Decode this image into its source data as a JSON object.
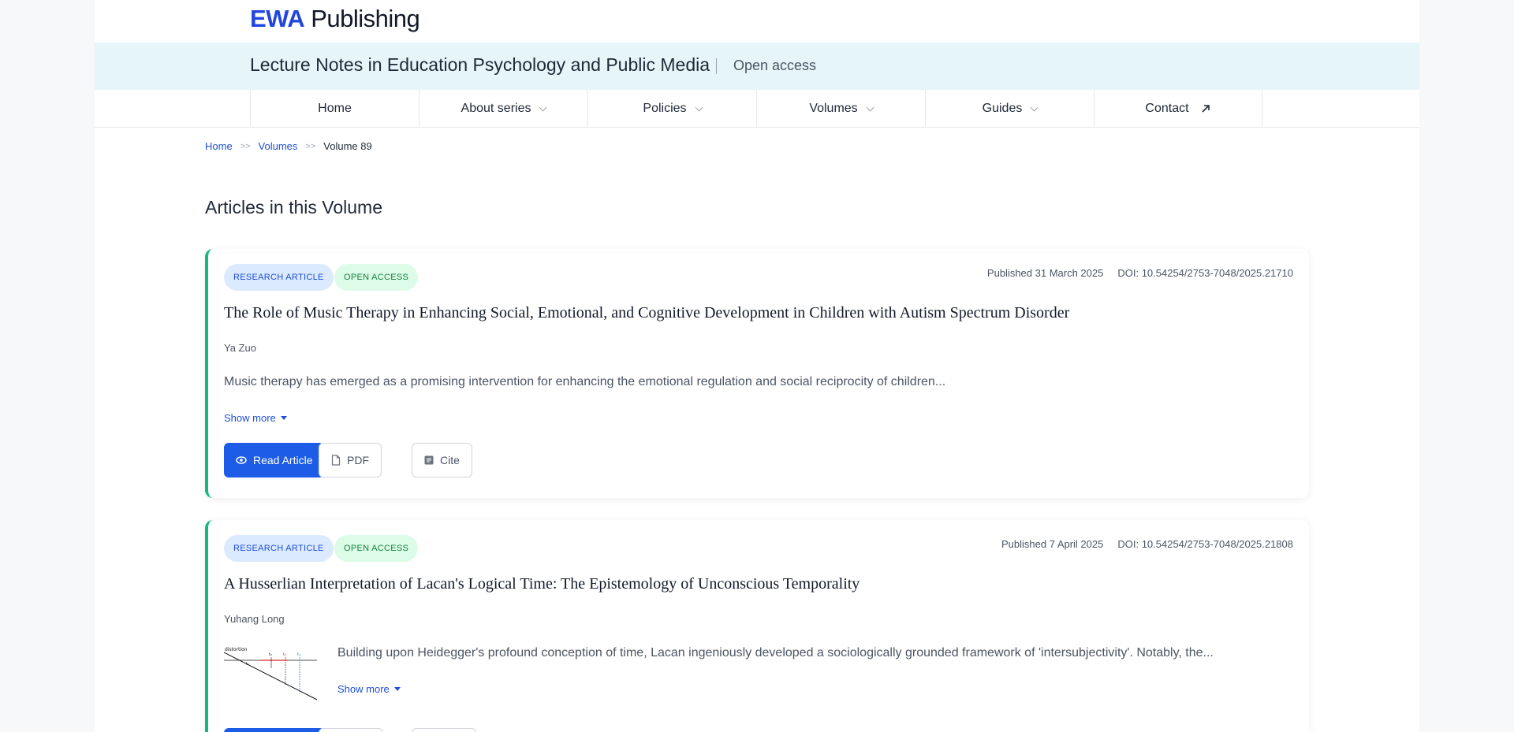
{
  "brand": {
    "logo_part1": "EWA",
    "logo_part2": " Publishing",
    "accent": "#2146e0"
  },
  "series": {
    "title": "Lecture Notes in Education Psychology and Public Media",
    "access": "Open access"
  },
  "nav": {
    "home": "Home",
    "about": "About series",
    "policies": "Policies",
    "volumes": "Volumes",
    "guides": "Guides",
    "contact": "Contact"
  },
  "breadcrumb": {
    "home": "Home",
    "sep": ">>",
    "volumes": "Volumes",
    "current": "Volume 89"
  },
  "section_title": "Articles in this Volume",
  "articles": [
    {
      "type": "RESEARCH ARTICLE",
      "access": "OPEN ACCESS",
      "published": "Published 31 March 2025",
      "doi": "DOI: 10.54254/2753-7048/2025.21710",
      "title": "The Role of Music Therapy in Enhancing Social, Emotional, and Cognitive Development in Children with Autism Spectrum Disorder",
      "author": "Ya Zuo",
      "abstract": "Music therapy has emerged as a promising intervention for enhancing the emotional regulation and social reciprocity of children...",
      "show_more": "Show more",
      "read": "Read Article",
      "pdf": "PDF",
      "cite": "Cite"
    },
    {
      "type": "RESEARCH ARTICLE",
      "access": "OPEN ACCESS",
      "published": "Published 7 April 2025",
      "doi": "DOI: 10.54254/2753-7048/2025.21808",
      "title": "A Husserlian Interpretation of Lacan's Logical Time: The Epistemology of Unconscious Temporality",
      "author": "Yuhang Long",
      "abstract": "Building upon Heidegger's profound conception of time, Lacan ingeniously developed a sociologically grounded framework of 'intersubjectivity'. Notably, the...",
      "show_more": "Show more",
      "thumb_label": "distortion",
      "thumb_t1": "t₁",
      "thumb_t2": "t₂",
      "thumb_t3": "t₃",
      "thumb_t4": "t₄"
    }
  ]
}
